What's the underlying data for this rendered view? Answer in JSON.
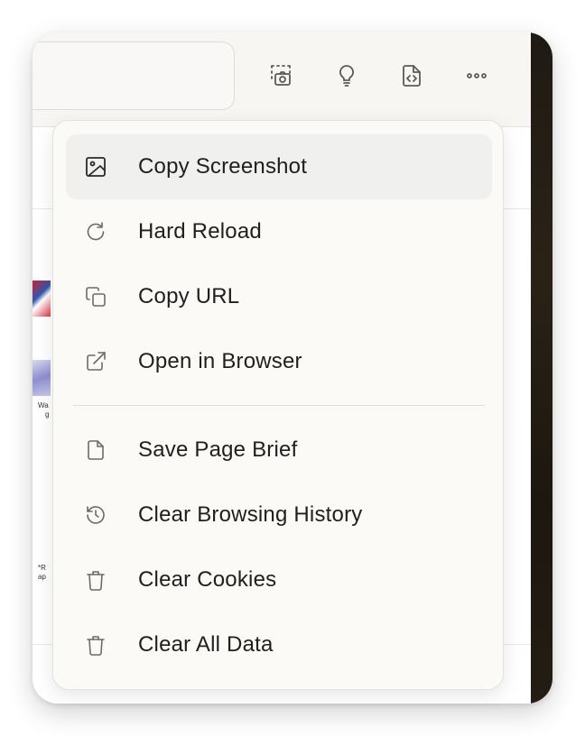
{
  "toolbar": {
    "buttons": [
      {
        "icon": "screenshot-icon"
      },
      {
        "icon": "lightbulb-icon"
      },
      {
        "icon": "code-file-icon"
      },
      {
        "icon": "more-icon"
      }
    ]
  },
  "background_page": {
    "fragments": [
      "Wa",
      "g",
      "*R",
      "ap"
    ]
  },
  "menu": {
    "group1": [
      {
        "label": "Copy Screenshot",
        "icon": "image-icon",
        "highlighted": true
      },
      {
        "label": "Hard Reload",
        "icon": "reload-icon",
        "highlighted": false
      },
      {
        "label": "Copy URL",
        "icon": "copy-icon",
        "highlighted": false
      },
      {
        "label": "Open in Browser",
        "icon": "external-link-icon",
        "highlighted": false
      }
    ],
    "group2": [
      {
        "label": "Save Page Brief",
        "icon": "file-icon",
        "highlighted": false
      },
      {
        "label": "Clear Browsing History",
        "icon": "history-icon",
        "highlighted": false
      },
      {
        "label": "Clear Cookies",
        "icon": "trash-icon",
        "highlighted": false
      },
      {
        "label": "Clear All Data",
        "icon": "trash-icon",
        "highlighted": false
      }
    ]
  },
  "colors": {
    "menu_bg": "#fbfaf7",
    "highlight_bg": "#f0f0ef",
    "text": "#1f1f1f",
    "icon": "#6b6b69"
  }
}
